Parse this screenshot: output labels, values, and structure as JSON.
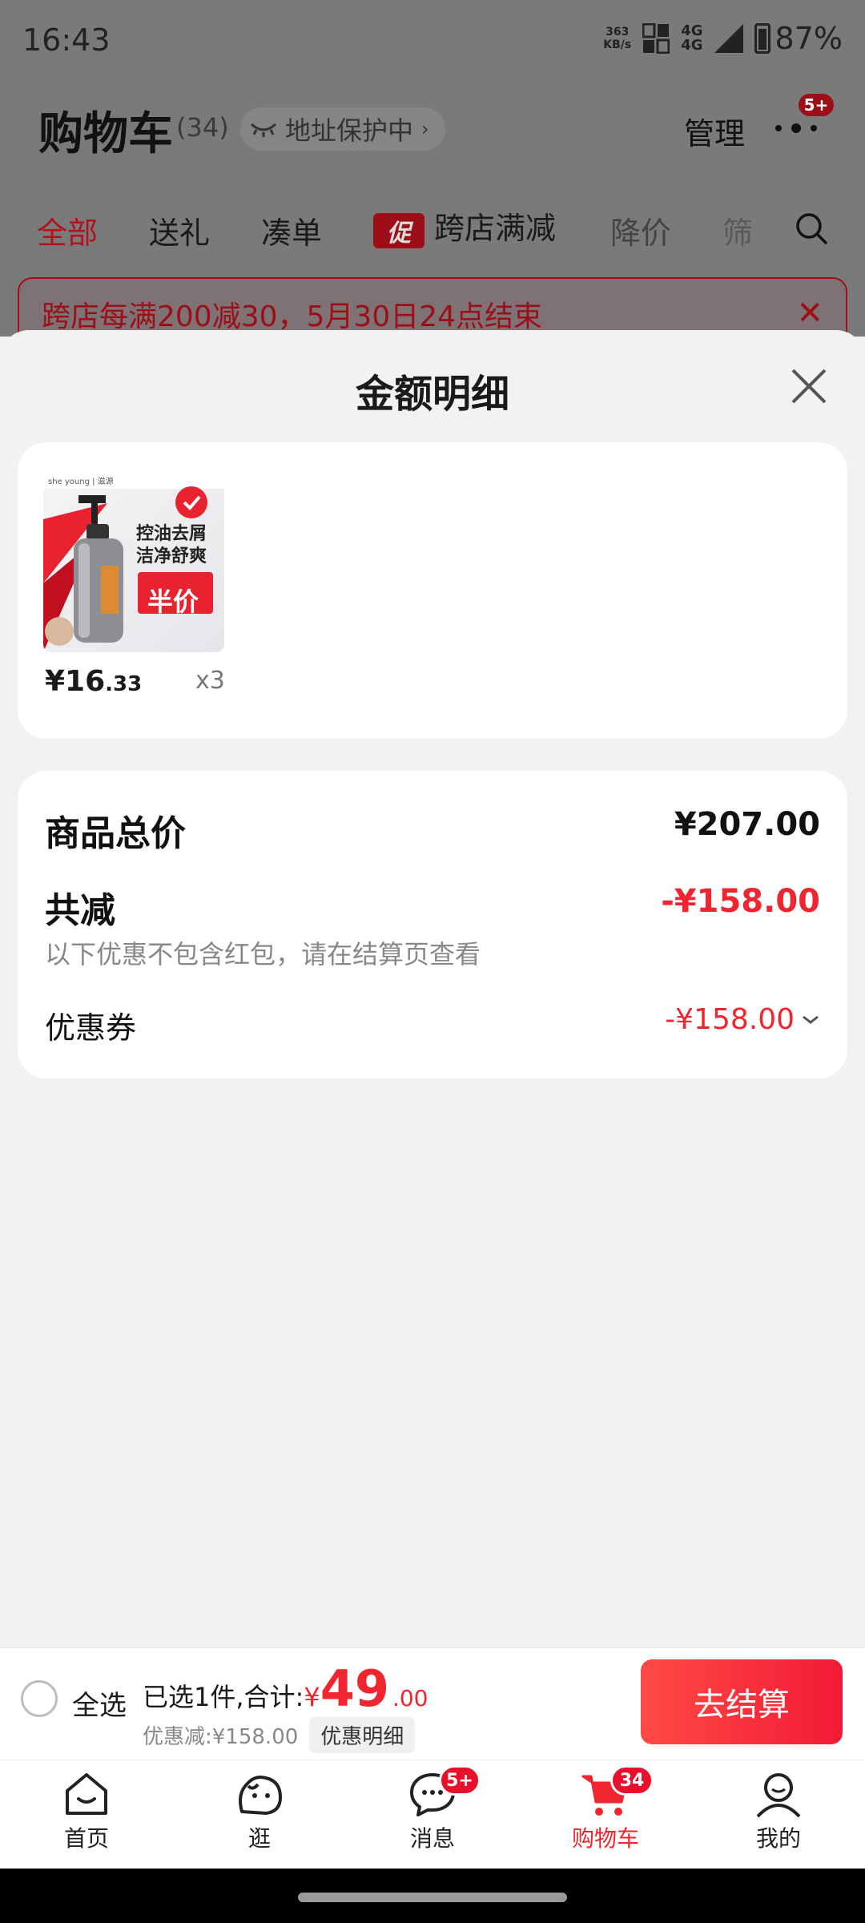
{
  "status_bar": {
    "time": "16:43",
    "net_speed_value": "363",
    "net_speed_unit": "KB/s",
    "signal_label_top": "4G",
    "signal_label_bottom": "4G",
    "battery": "87%"
  },
  "header": {
    "title": "购物车",
    "count": "(34)",
    "address_protection": "地址保护中",
    "manage": "管理",
    "more_badge": "5+"
  },
  "filters": {
    "tabs": [
      {
        "label": "全部"
      },
      {
        "label": "送礼"
      },
      {
        "label": "凑单"
      },
      {
        "label": "跨店满减",
        "tag": "促"
      },
      {
        "label": "降价"
      },
      {
        "label": "筛"
      }
    ]
  },
  "notice": {
    "text": "跨店每满200减30，5月30日24点结束"
  },
  "sheet": {
    "title": "金额明细",
    "items": [
      {
        "image_text_1": "控油去屑",
        "image_text_2": "洁净舒爽",
        "image_badge": "半价",
        "image_brand": "she young | 滋源",
        "price_int": "¥16",
        "price_dec": ".33",
        "qty": "x3"
      }
    ],
    "summary": {
      "total_label": "商品总价",
      "total_value": "¥207.00",
      "reduce_label": "共减",
      "reduce_value": "-¥158.00",
      "hint": "以下优惠不包含红包，请在结算页查看",
      "coupon_label": "优惠券",
      "coupon_value": "-¥158.00"
    }
  },
  "checkout": {
    "select_all": "全选",
    "selected_prefix": "已选1件,合计:",
    "yen": "¥",
    "amount_int": "49",
    "amount_dec": ".00",
    "discount_text": "优惠减:¥158.00",
    "detail_chip": "优惠明细",
    "button": "去结算"
  },
  "tabbar": {
    "tabs": [
      {
        "label": "首页"
      },
      {
        "label": "逛"
      },
      {
        "label": "消息",
        "badge": "5+"
      },
      {
        "label": "购物车",
        "badge": "34"
      },
      {
        "label": "我的"
      }
    ]
  },
  "colors": {
    "accent": "#f0252f",
    "overlay": "#7a7a7a"
  }
}
